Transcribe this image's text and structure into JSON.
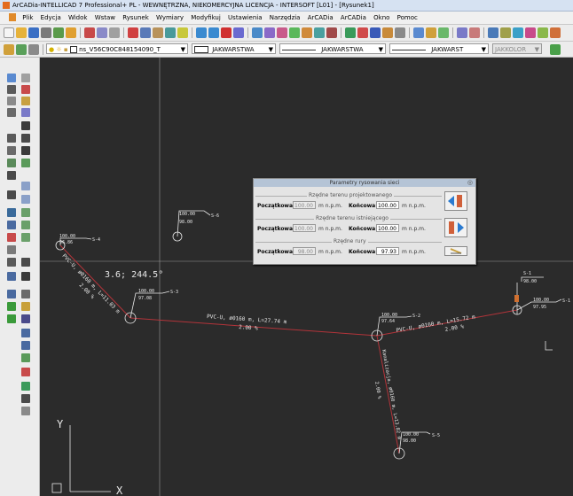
{
  "window": {
    "title": "ArCADia-INTELLICAD 7 Professional+ PL - WEWNĘTRZNA, NIEKOMERCYJNA LICENCJA - INTERSOFT [L01] - [Rysunek1]"
  },
  "menu": {
    "items": [
      "Plik",
      "Edycja",
      "Widok",
      "Wstaw",
      "Rysunek",
      "Wymiary",
      "Modyfikuj",
      "Ustawienia",
      "Narzędzia",
      "ArCADia",
      "ArCADia",
      "Okno",
      "Pomoc"
    ]
  },
  "toolbar2": {
    "layer_value": "ns_V56C90C848154090_T",
    "linetype_value": "JAKWARSTWA",
    "lineweight_value": "JAKWARSTWA",
    "plotstyle_value": "JAKWARST",
    "color_value": "JAKKOLOR"
  },
  "colors": {
    "canvas_bg": "#2b2b2b",
    "pipe_line": "#b3343a",
    "cad_text": "#e8e8e8",
    "dialog_title": "#b5c4d6"
  },
  "drawing": {
    "cursor_readout": "3.6; 244.5°",
    "axis_x": "X",
    "axis_y": "Y",
    "nodes": [
      {
        "name": "S-4",
        "top": "100.00",
        "bottom": "96.86"
      },
      {
        "name": "S-6",
        "top": "100.00",
        "bottom": "98.00"
      },
      {
        "name": "S-3",
        "top": "100.00",
        "bottom": "97.08"
      },
      {
        "name": "S-2",
        "top": "100.00",
        "bottom": "97.64"
      },
      {
        "name": "S-1",
        "top": "100.00",
        "bottom": "97.95"
      },
      {
        "name": "S-5",
        "top": "100.00",
        "bottom": "98.00"
      },
      {
        "name": "S-1",
        "top": "",
        "bottom": "98.00"
      }
    ],
    "pipes": [
      {
        "label": "PVC-U, ø0160 m, L=11.03 m",
        "slope": "2.00 %"
      },
      {
        "label": "PVC-U, ø0160 m, L=27.74 m",
        "slope": "2.00 %"
      },
      {
        "label": "PVC-U, ø0160 m, L=15.72 m",
        "slope": "2.00 %"
      },
      {
        "label": "Kanalizacja, ø0160 m, L=13.82 m",
        "slope": "2.00 %"
      }
    ]
  },
  "dialog": {
    "title": "Parametry rysowania sieci",
    "group1_title": "Rzędne terenu projektowanego",
    "group2_title": "Rzędne terenu istniejącego",
    "group3_title": "Rzędne rury",
    "start_label": "Początkowa:",
    "end_label": "Końcowa:",
    "unit": "m n.p.m.",
    "row1": {
      "start": "100.00",
      "end": "100.00"
    },
    "row2": {
      "start": "100.00",
      "end": "100.00"
    },
    "row3": {
      "start": "98.00",
      "end": "97.93"
    }
  }
}
